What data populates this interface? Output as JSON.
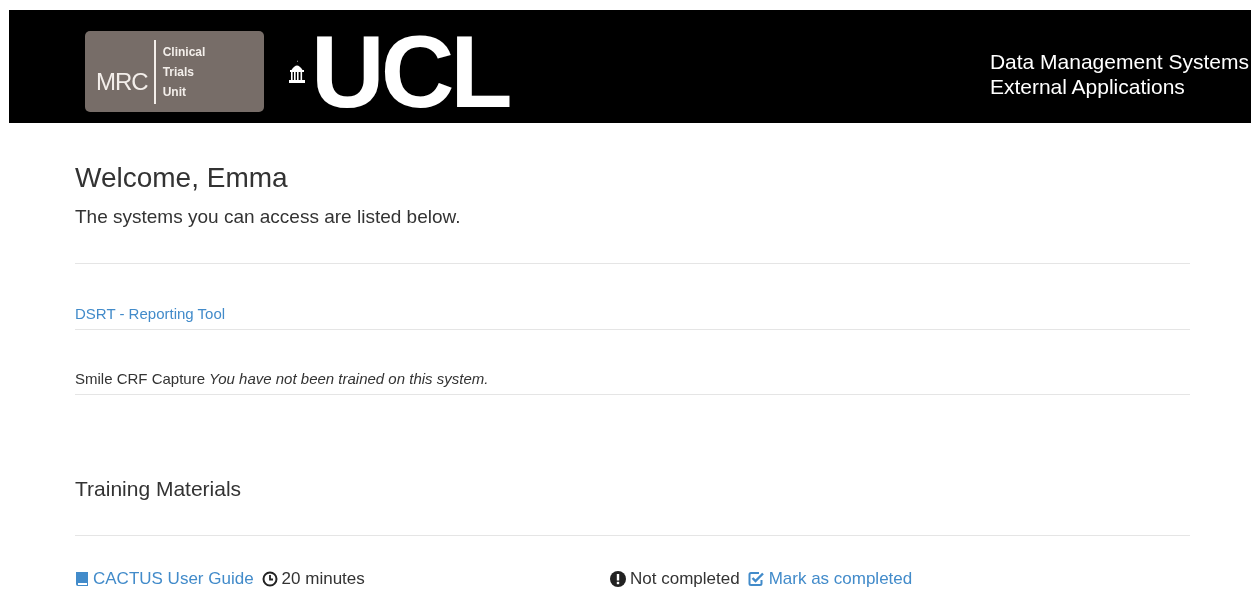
{
  "header": {
    "mrc_logo": {
      "acronym": "MRC",
      "lines": [
        "Clinical",
        "Trials",
        "Unit"
      ]
    },
    "ucl_logo": "UCL",
    "title_lines": [
      "Data Management Systems",
      "External Applications"
    ]
  },
  "welcome": {
    "heading": "Welcome, Emma",
    "intro": "The systems you can access are listed below."
  },
  "systems": [
    {
      "kind": "link",
      "name": "DSRT - Reporting Tool"
    },
    {
      "kind": "untrained",
      "name": "Smile CRF Capture",
      "note": "You have not been trained on this system."
    }
  ],
  "training": {
    "heading": "Training Materials",
    "items": [
      {
        "title": "CACTUS User Guide",
        "duration": "20 minutes",
        "completed": false,
        "status": "Not completed",
        "action": "Mark as completed"
      }
    ]
  }
}
